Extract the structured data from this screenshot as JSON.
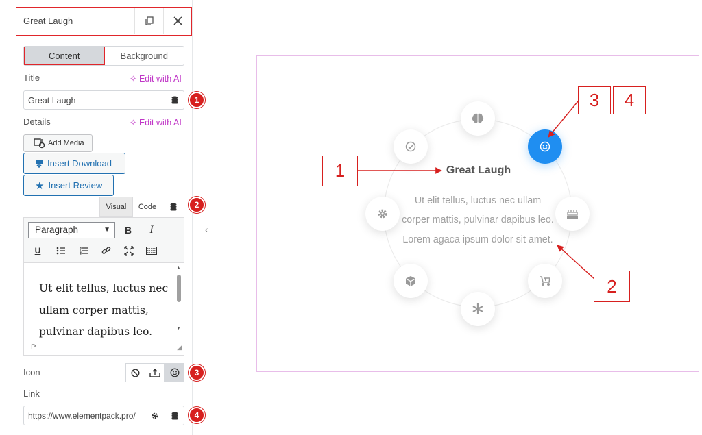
{
  "panel": {
    "title": "Great Laugh",
    "tabs": {
      "content": "Content",
      "background": "Background"
    },
    "title_field": {
      "label": "Title",
      "ai_label": "Edit with AI",
      "value": "Great Laugh"
    },
    "details": {
      "label": "Details",
      "ai_label": "Edit with AI"
    },
    "media_buttons": {
      "add_media": "Add Media",
      "insert_download": "Insert Download",
      "insert_review": "Insert Review"
    },
    "editor": {
      "mode_visual": "Visual",
      "mode_code": "Code",
      "format_select": "Paragraph",
      "content": "Ut elit tellus, luctus nec ullam corper mattis, pulvinar dapibus leo.",
      "status_path": "P"
    },
    "icon_field": {
      "label": "Icon"
    },
    "link_field": {
      "label": "Link",
      "value": "https://www.elementpack.pro/"
    },
    "badges": [
      "1",
      "2",
      "3",
      "4"
    ]
  },
  "preview": {
    "title": "Great Laugh",
    "text": "Ut elit tellus, luctus nec ullam corper mattis, pulvinar dapibus leo. Lorem agaca ipsum dolor sit amet.",
    "active_color": "#1f8ef1",
    "nodes": [
      "brain-icon",
      "smile-icon",
      "cake-icon",
      "stroller-icon",
      "asterisk-icon",
      "cube-icon",
      "gear-icon",
      "check-circle-icon"
    ]
  },
  "callouts": {
    "one": "1",
    "two": "2",
    "three": "3",
    "four": "4"
  },
  "colors": {
    "annotation_red": "#d7201f",
    "ai_purple": "#c036c7",
    "wp_blue": "#2271b1",
    "preview_border": "#e8bde9"
  }
}
